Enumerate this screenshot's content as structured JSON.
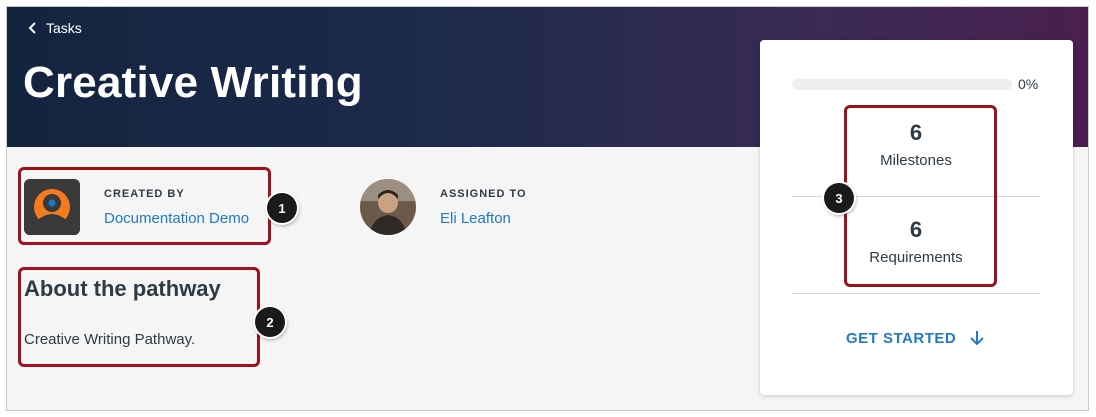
{
  "nav": {
    "back_label": "Tasks"
  },
  "header": {
    "title": "Creative Writing"
  },
  "created_by": {
    "label": "CREATED BY",
    "name": "Documentation Demo"
  },
  "assigned_to": {
    "label": "ASSIGNED TO",
    "name": "Eli Leafton"
  },
  "about": {
    "heading": "About the pathway",
    "body": "Creative Writing Pathway."
  },
  "progress": {
    "value_text": "0%",
    "fraction": 0
  },
  "stats": {
    "milestones": {
      "count": "6",
      "label": "Milestones"
    },
    "requirements": {
      "count": "6",
      "label": "Requirements"
    }
  },
  "actions": {
    "get_started": "GET STARTED"
  },
  "callouts": [
    "1",
    "2",
    "3"
  ],
  "colors": {
    "accent": "#1f7ac7",
    "callout_border": "#a0111c",
    "banner_dark": "#13243f",
    "banner_purple": "#4a1f4f"
  },
  "icons": [
    "chevron-left-icon",
    "creator-logo-icon",
    "user-avatar-photo",
    "arrow-down-icon"
  ]
}
